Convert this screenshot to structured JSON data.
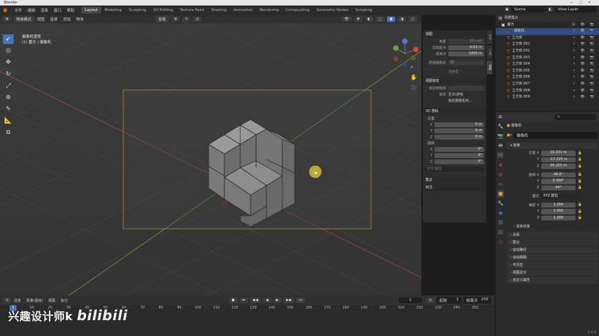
{
  "titlebar": {
    "title": "Blender"
  },
  "menubar": {
    "menus": [
      "文件",
      "编辑",
      "渲染",
      "窗口",
      "帮助"
    ],
    "workspaces": [
      "Layout",
      "Modeling",
      "Sculpting",
      "UV Editing",
      "Texture Paint",
      "Shading",
      "Animation",
      "Rendering",
      "Compositing",
      "Geometry Nodes",
      "Scripting"
    ],
    "scene": "Scene",
    "view_layer": "View Layer"
  },
  "viewport_header": {
    "mode": "物体模式",
    "menus": [
      "视图",
      "选择",
      "添加",
      "物体"
    ],
    "orientation": "全局"
  },
  "viewinfo": {
    "line1": "摄像机透视",
    "line2": "(1) 魔方 | 摄像机"
  },
  "npanel": {
    "view_section": "视图",
    "focal_label": "焦距",
    "focal_value": "50 mm",
    "clip_start_label": "剪辑起点",
    "clip_start_value": "0.01 m",
    "clip_end_label": "结束点",
    "clip_end_value": "1000 m",
    "local_cam_label": "局部摄像机",
    "local_cam_value": "摄",
    "render_region": "渲染框",
    "view_lock": "视图锁定",
    "lock_to_obj_label": "锁定到物体",
    "lock_label": "锁定",
    "lock_3d_cursor": "至3D游标",
    "lock_cam_view": "锁定摄像机到...",
    "cursor_section": "3D 游标",
    "location_label": "位置:",
    "cursor_x": "0 m",
    "cursor_y": "0 m",
    "cursor_z": "0 m",
    "rotation_label": "旋转:",
    "rot_x": "0°",
    "rot_y": "0°",
    "rot_z": "0°",
    "rot_mode": "XYZ 欧拉",
    "collection_section": "集合",
    "annotation_section": "标注"
  },
  "sidetabs": [
    "物体",
    "工具",
    "视图"
  ],
  "outliner": {
    "title": "场景集合",
    "rows": [
      {
        "name": "魔方",
        "level": 1
      },
      {
        "name": "摄像机",
        "level": 2
      },
      {
        "name": "立方体",
        "level": 2
      },
      {
        "name": "立方体.001",
        "level": 2
      },
      {
        "name": "立方体.002",
        "level": 2
      },
      {
        "name": "立方体.003",
        "level": 2
      },
      {
        "name": "立方体.004",
        "level": 2
      },
      {
        "name": "立方体.005",
        "level": 2
      },
      {
        "name": "立方体.006",
        "level": 2
      },
      {
        "name": "立方体.007",
        "level": 2
      },
      {
        "name": "立方体.008",
        "level": 2
      },
      {
        "name": "立方体.009",
        "level": 2
      }
    ]
  },
  "props": {
    "breadcrumb": "摄像机",
    "object_name": "摄像机",
    "transform_section": "变换",
    "loc_label": "位置 X",
    "loc_x": "20.331 m",
    "loc_y": "-17.225 m",
    "loc_z": "26.255 m",
    "rot_label": "旋转 X",
    "rot_x": "46.8°",
    "rot_y": "0.368°",
    "rot_z": "44°",
    "mode_label": "模式",
    "mode_value": "XYZ 欧拉",
    "scale_label": "缩放 X",
    "scale_x": "1.000",
    "scale_y": "1.000",
    "scale_z": "1.000",
    "delta": "变换增量",
    "sections": [
      "关系",
      "集合",
      "运动路径",
      "运动模糊",
      "可见性",
      "视图显示",
      "自定义属性"
    ],
    "axis_y": "Y",
    "axis_z": "Z"
  },
  "timeline": {
    "menus": [
      "回放",
      "抠像(插帧)",
      "视图",
      "标记"
    ],
    "current_frame": "1",
    "start_label": "起始",
    "start": "1",
    "end_label": "结束点",
    "end": "250",
    "ticks": [
      0,
      10,
      20,
      30,
      40,
      50,
      60,
      70,
      80,
      90,
      100,
      110,
      120,
      130,
      140,
      150,
      160,
      170,
      180,
      190,
      200,
      210,
      220,
      230,
      240,
      250
    ]
  },
  "watermark": {
    "text": "兴趣设计师k",
    "logo": "bilibili"
  },
  "version": "3.0.0",
  "colors": {
    "accent": "#4772b3",
    "orange": "#e39b45",
    "viewport": "#3a3a3a",
    "cube": "#8a8a8a"
  }
}
